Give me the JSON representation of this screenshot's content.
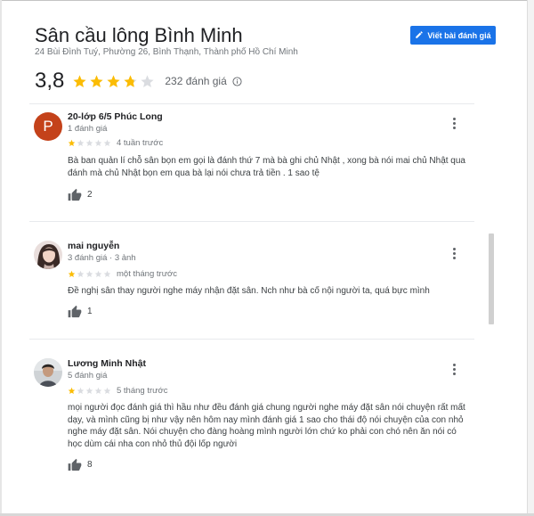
{
  "place": {
    "name": "Sân cầu lông Bình Minh",
    "address": "24 Bùi Đình Tuý, Phường 26, Bình Thạnh, Thành phố Hồ Chí Minh",
    "rating": "3,8",
    "rating_stars": 3.8,
    "review_count": "232 đánh giá"
  },
  "actions": {
    "write_review": "Viết bài đánh giá"
  },
  "colors": {
    "accent": "#1a73e8",
    "star": "#fbbc04",
    "star_empty": "#dadce0",
    "avatar_p": "#c4421a"
  },
  "reviews": [
    {
      "author": "20-lớp 6/5 Phúc Long",
      "avatar_letter": "P",
      "meta": "1 đánh giá",
      "stars": 1,
      "date": "4 tuần trước",
      "text": "Bà ban quản lí chỗ sân bọn em gọi là đánh thứ 7 mà bà ghi chủ Nhật ,  xong bà nói mai chủ Nhật qua đánh mà chủ Nhật bọn em qua bà lại nói chưa trả tiền . 1 sao tệ",
      "likes": "2"
    },
    {
      "author": "mai nguyễn",
      "meta": "3 đánh giá · 3 ảnh",
      "stars": 1,
      "date": "một tháng trước",
      "text": "Đề nghị sân thay người nghe máy nhận đặt sân. Nch như bà cố nội người ta, quá bực mình",
      "likes": "1"
    },
    {
      "author": "Lương Minh Nhật",
      "meta": "5 đánh giá",
      "stars": 1,
      "date": "5 tháng trước",
      "text": "mọi người đọc đánh giá thì hầu như đều đánh giá chung người nghe máy đặt sân nói chuyện rất mất dạy, và mình cũng bị như vậy nên hôm nay mình đánh giá 1 sao cho thái độ nói chuyện của con nhỏ nghe máy đặt sân. Nói chuyện cho đàng hoàng mình người lớn chứ ko phải con chó nên ăn nói có học dùm cái nha con nhỏ thủ đội lốp người",
      "likes": "8"
    }
  ]
}
